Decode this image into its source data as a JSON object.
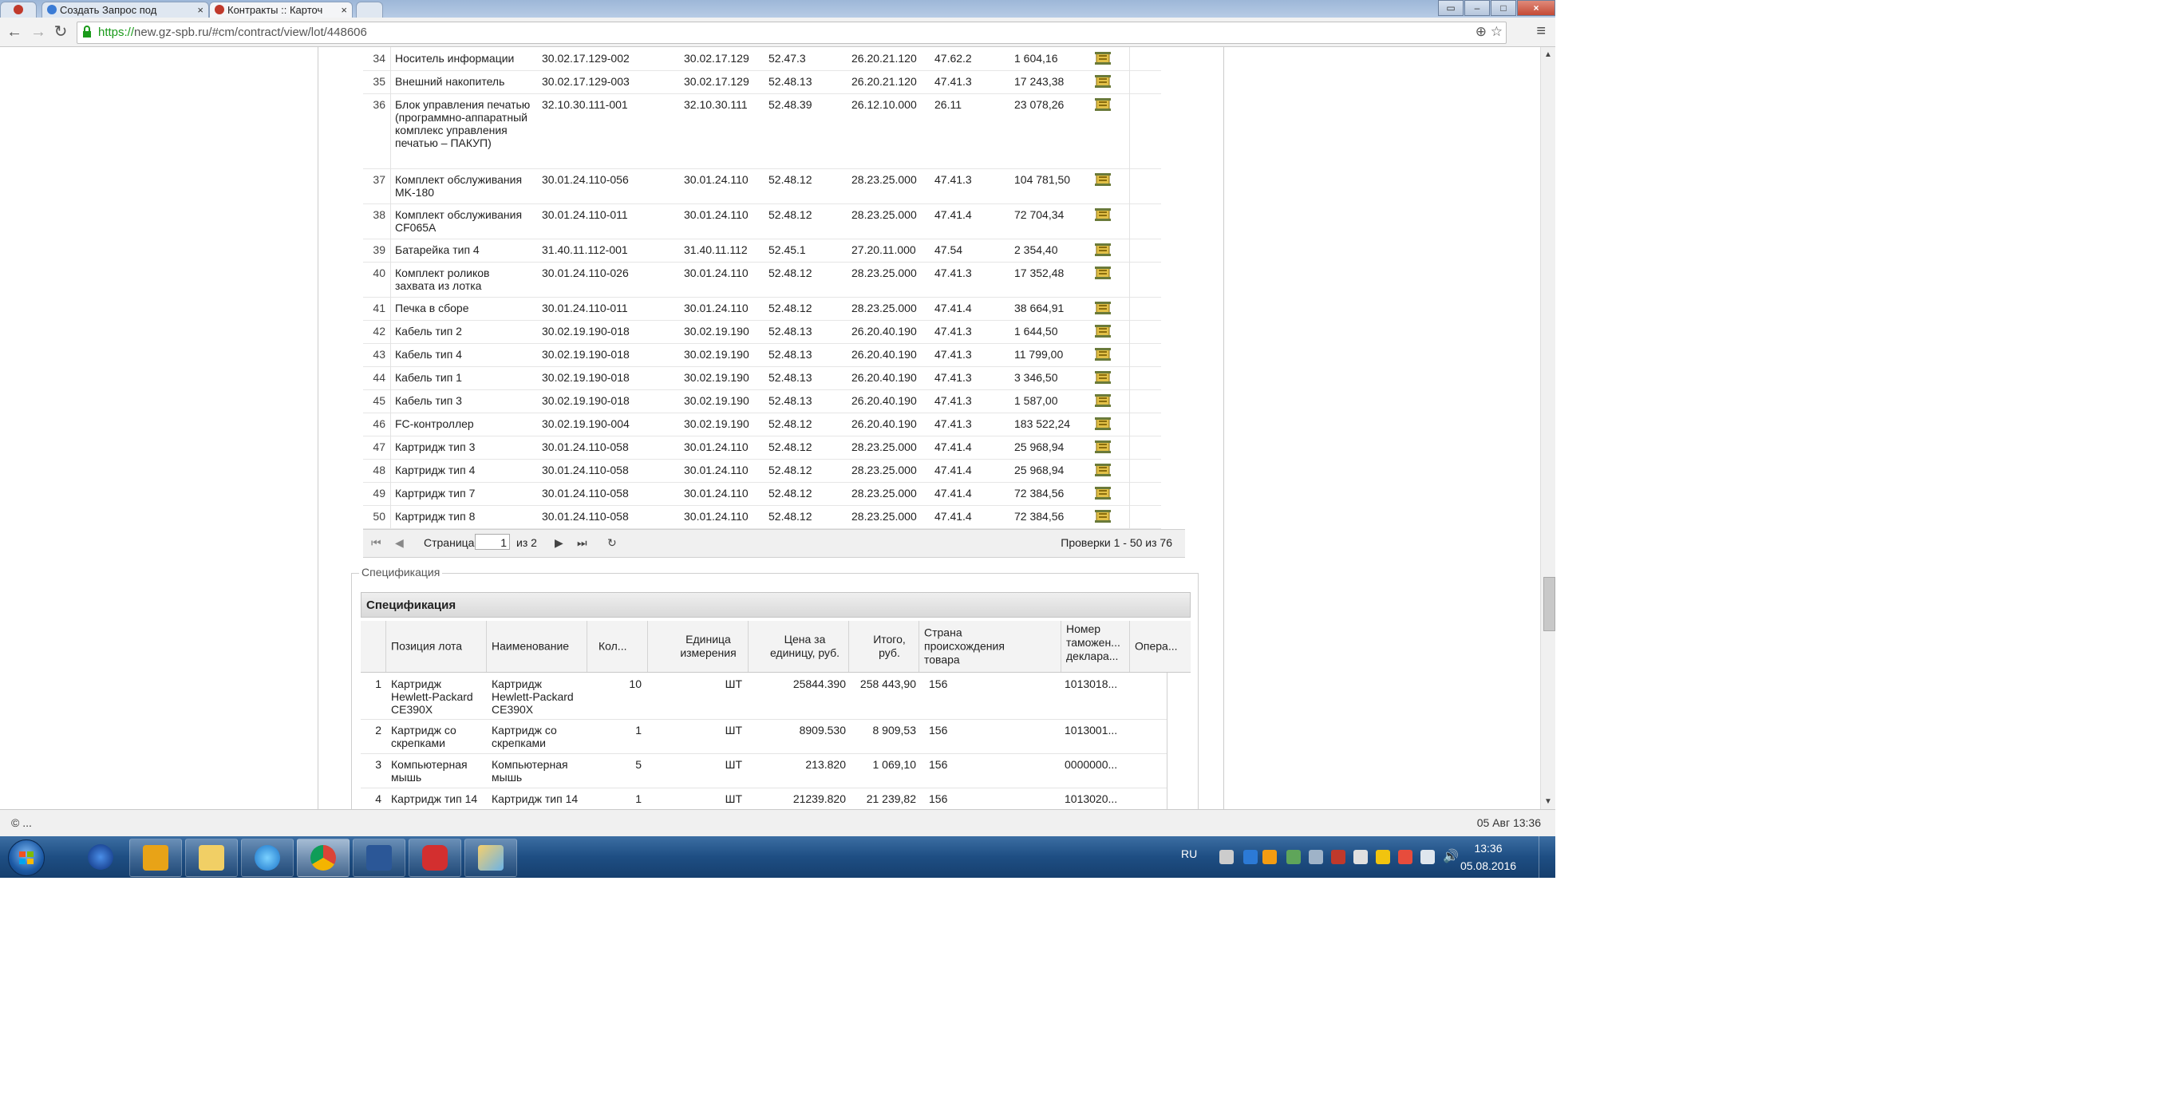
{
  "browser": {
    "tabs": [
      {
        "label": "Создать Запрос под"
      },
      {
        "label": "Контракты :: Карточ"
      }
    ],
    "url_scheme": "https://",
    "url_rest": "new.gz-spb.ru/#cm/contract/view/lot/448606"
  },
  "lot_table": {
    "rows": [
      {
        "n": "34",
        "name": "Носитель информации",
        "c1": "30.02.17.129-002",
        "c2": "30.02.17.129",
        "c3": "52.47.3",
        "c4": "26.20.21.120",
        "c5": "47.62.2",
        "sum": "1 604,16"
      },
      {
        "n": "35",
        "name": "Внешний накопитель",
        "c1": "30.02.17.129-003",
        "c2": "30.02.17.129",
        "c3": "52.48.13",
        "c4": "26.20.21.120",
        "c5": "47.41.3",
        "sum": "17 243,38"
      },
      {
        "n": "36",
        "name": "Блок управления печатью (программно-аппаратный комплекс управления печатью – ПАКУП)",
        "c1": "32.10.30.111-001",
        "c2": "32.10.30.111",
        "c3": "52.48.39",
        "c4": "26.12.10.000",
        "c5": "26.11",
        "sum": "23 078,26"
      },
      {
        "n": "37",
        "name": "Комплект обслуживания MK-180",
        "c1": "30.01.24.110-056",
        "c2": "30.01.24.110",
        "c3": "52.48.12",
        "c4": "28.23.25.000",
        "c5": "47.41.3",
        "sum": "104 781,50"
      },
      {
        "n": "38",
        "name": "Комплект обслуживания CF065A",
        "c1": "30.01.24.110-011",
        "c2": "30.01.24.110",
        "c3": "52.48.12",
        "c4": "28.23.25.000",
        "c5": "47.41.4",
        "sum": "72 704,34"
      },
      {
        "n": "39",
        "name": "Батарейка тип 4",
        "c1": "31.40.11.112-001",
        "c2": "31.40.11.112",
        "c3": "52.45.1",
        "c4": "27.20.11.000",
        "c5": "47.54",
        "sum": "2 354,40"
      },
      {
        "n": "40",
        "name": "Комплект роликов захвата из лотка",
        "c1": "30.01.24.110-026",
        "c2": "30.01.24.110",
        "c3": "52.48.12",
        "c4": "28.23.25.000",
        "c5": "47.41.3",
        "sum": "17 352,48"
      },
      {
        "n": "41",
        "name": "Печка в сборе",
        "c1": "30.01.24.110-011",
        "c2": "30.01.24.110",
        "c3": "52.48.12",
        "c4": "28.23.25.000",
        "c5": "47.41.4",
        "sum": "38 664,91"
      },
      {
        "n": "42",
        "name": "Кабель тип 2",
        "c1": "30.02.19.190-018",
        "c2": "30.02.19.190",
        "c3": "52.48.13",
        "c4": "26.20.40.190",
        "c5": "47.41.3",
        "sum": "1 644,50"
      },
      {
        "n": "43",
        "name": "Кабель тип 4",
        "c1": "30.02.19.190-018",
        "c2": "30.02.19.190",
        "c3": "52.48.13",
        "c4": "26.20.40.190",
        "c5": "47.41.3",
        "sum": "11 799,00"
      },
      {
        "n": "44",
        "name": "Кабель тип 1",
        "c1": "30.02.19.190-018",
        "c2": "30.02.19.190",
        "c3": "52.48.13",
        "c4": "26.20.40.190",
        "c5": "47.41.3",
        "sum": "3 346,50"
      },
      {
        "n": "45",
        "name": "Кабель тип 3",
        "c1": "30.02.19.190-018",
        "c2": "30.02.19.190",
        "c3": "52.48.13",
        "c4": "26.20.40.190",
        "c5": "47.41.3",
        "sum": "1 587,00"
      },
      {
        "n": "46",
        "name": "FC-контроллер",
        "c1": "30.02.19.190-004",
        "c2": "30.02.19.190",
        "c3": "52.48.12",
        "c4": "26.20.40.190",
        "c5": "47.41.3",
        "sum": "183 522,24"
      },
      {
        "n": "47",
        "name": "Картридж тип 3",
        "c1": "30.01.24.110-058",
        "c2": "30.01.24.110",
        "c3": "52.48.12",
        "c4": "28.23.25.000",
        "c5": "47.41.4",
        "sum": "25 968,94"
      },
      {
        "n": "48",
        "name": "Картридж тип 4",
        "c1": "30.01.24.110-058",
        "c2": "30.01.24.110",
        "c3": "52.48.12",
        "c4": "28.23.25.000",
        "c5": "47.41.4",
        "sum": "25 968,94"
      },
      {
        "n": "49",
        "name": "Картридж тип 7",
        "c1": "30.01.24.110-058",
        "c2": "30.01.24.110",
        "c3": "52.48.12",
        "c4": "28.23.25.000",
        "c5": "47.41.4",
        "sum": "72 384,56"
      },
      {
        "n": "50",
        "name": "Картридж тип 8",
        "c1": "30.01.24.110-058",
        "c2": "30.01.24.110",
        "c3": "52.48.12",
        "c4": "28.23.25.000",
        "c5": "47.41.4",
        "sum": "72 384,56"
      }
    ]
  },
  "pager": {
    "page_label": "Страница",
    "page_value": "1",
    "of_label": "из 2",
    "summary": "Проверки 1 - 50 из 76"
  },
  "spec": {
    "legend": "Спецификация",
    "header": "Спецификация",
    "columns": {
      "pos": "Позиция лота",
      "name": "Наименование",
      "qty": "Кол...",
      "unit": "Единица измерения",
      "price": "Цена за единицу, руб.",
      "total": "Итого, руб.",
      "country": "Страна происхождения товара",
      "customs": "Номер таможен... деклара...",
      "ops": "Опера..."
    },
    "rows": [
      {
        "n": "1",
        "pos": "Картридж Hewlett-Packard CE390X",
        "name": "Картридж Hewlett-Packard CE390X",
        "qty": "10",
        "unit": "ШТ",
        "price": "25844.390",
        "total": "258 443,90",
        "country": "156",
        "customs": "1013018..."
      },
      {
        "n": "2",
        "pos": "Картридж со скрепками",
        "name": "Картридж со скрепками",
        "qty": "1",
        "unit": "ШТ",
        "price": "8909.530",
        "total": "8 909,53",
        "country": "156",
        "customs": "1013001..."
      },
      {
        "n": "3",
        "pos": "Компьютерная мышь",
        "name": "Компьютерная мышь",
        "qty": "5",
        "unit": "ШТ",
        "price": "213.820",
        "total": "1 069,10",
        "country": "156",
        "customs": "0000000..."
      },
      {
        "n": "4",
        "pos": "Картридж тип 14",
        "name": "Картридж тип 14",
        "qty": "1",
        "unit": "ШТ",
        "price": "21239.820",
        "total": "21 239,82",
        "country": "156",
        "customs": "1013020..."
      }
    ]
  },
  "status": {
    "left": "© ...",
    "right": "05 Авг 13:36"
  },
  "taskbar": {
    "lang": "RU",
    "time": "13:36",
    "date": "05.08.2016",
    "apps": [
      "windows-media-icon",
      "outlook-icon",
      "explorer-folder-icon",
      "internet-explorer-icon",
      "chrome-icon",
      "word-icon",
      "screen-recorder-icon",
      "paint-icon"
    ]
  }
}
